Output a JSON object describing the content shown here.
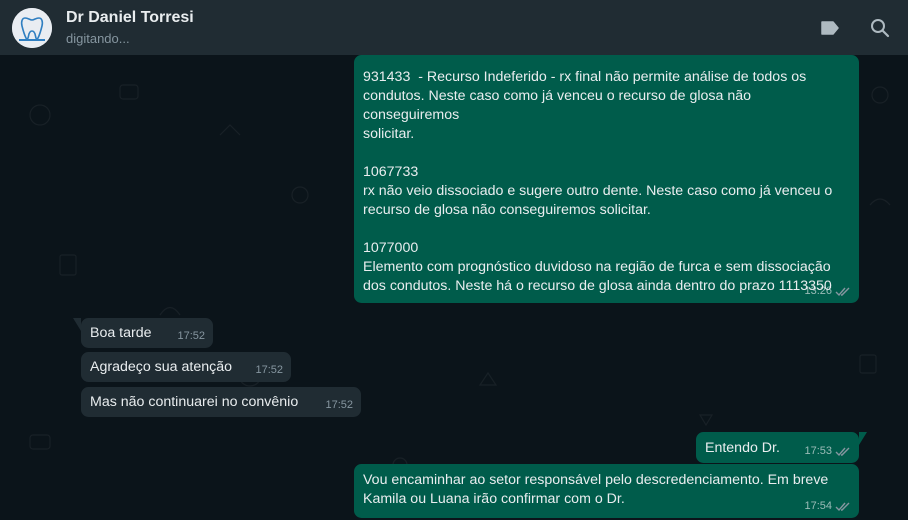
{
  "header": {
    "contact_name": "Dr Daniel Torresi",
    "contact_status": "digitando...",
    "icons": [
      "avatar-dental-logo",
      "label-icon",
      "search-icon"
    ]
  },
  "messages": [
    {
      "direction": "outgoing",
      "text": "931433  - Recurso Indeferido - rx final não permite análise de todos os\ncondutos. Neste caso como já venceu o recurso de glosa não conseguiremos\nsolicitar.\n\n1067733\nrx não veio dissociado e sugere outro dente. Neste caso como já venceu o\nrecurso de glosa não conseguiremos solicitar.\n\n1077000\nElemento com prognóstico duvidoso na região de furca e sem dissociação\ndos condutos. Neste há o recurso de glosa ainda dentro do prazo 1113350",
      "time": "13:26",
      "status": "read"
    },
    {
      "direction": "incoming",
      "text": "Boa tarde",
      "time": "17:52"
    },
    {
      "direction": "incoming",
      "text": "Agradeço sua atenção",
      "time": "17:52"
    },
    {
      "direction": "incoming",
      "text": "Mas não continuarei no convênio",
      "time": "17:52"
    },
    {
      "direction": "outgoing",
      "text": "Entendo Dr.",
      "time": "17:53",
      "status": "read"
    },
    {
      "direction": "outgoing",
      "text": "Vou encaminhar ao setor responsável pelo descredenciamento. Em breve\nKamila ou Luana irão confirmar com o Dr.",
      "time": "17:54",
      "status": "read"
    }
  ],
  "colors": {
    "background": "#0b141a",
    "header": "#202c33",
    "outgoing_bubble": "#005c4b",
    "incoming_bubble": "#202c33",
    "read_ticks": "#8696a0"
  }
}
